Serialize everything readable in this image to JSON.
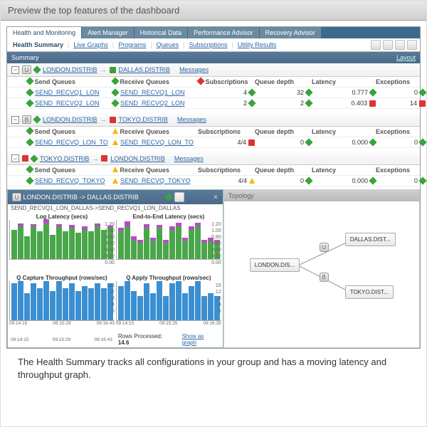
{
  "header": "Preview the top features of the dashboard",
  "tabs": [
    "Health and Monitoring",
    "Alert Manager",
    "Historical Data",
    "Performance Advisor",
    "Recovery Advisor"
  ],
  "subtabs": [
    "Health Summary",
    "Live Graphs",
    "Programs",
    "Queues",
    "Subscriptions",
    "Utility Results"
  ],
  "summary": {
    "title": "Summary",
    "layout": "Layout"
  },
  "groups": [
    {
      "status": "green",
      "badge": "U",
      "src": "LONDON.DISTRIB",
      "dst": "DALLAS.DISTRIB",
      "srcColor": "green",
      "dstColor": "green",
      "msgs": "Messages",
      "cols": [
        "Send Queues",
        "Receive Queues",
        "Subscriptions",
        "Queue depth",
        "Latency",
        "Exceptions"
      ],
      "colIcons": [
        "green",
        "green",
        "red",
        "",
        "",
        ""
      ],
      "rows": [
        {
          "send": "SEND_RECVQ1_LON",
          "recv": "SEND_RECVQ1_LON",
          "subs": "4",
          "subIcon": "green",
          "depth": "32",
          "depthIcon": "green",
          "lat": "0.777",
          "latIcon": "green",
          "exc": "0",
          "excIcon": "green"
        },
        {
          "send": "SEND_RECVQ2_LON",
          "recv": "SEND_RECVQ2_LON",
          "subs": "2",
          "subIcon": "green",
          "depth": "2",
          "depthIcon": "green",
          "lat": "0.403",
          "latIcon": "red",
          "exc": "14",
          "excIcon": "red"
        }
      ]
    },
    {
      "status": "green",
      "badge": "B",
      "src": "LONDON.DISTRIB",
      "dst": "TOKYO.DISTRIB",
      "srcColor": "green",
      "dstColor": "red",
      "msgs": "Messages",
      "cols": [
        "Send Queues",
        "Receive Queues",
        "Subscriptions",
        "Queue depth",
        "Latency",
        "Exceptions"
      ],
      "colIcons": [
        "green",
        "yellow",
        "",
        "",
        "",
        ""
      ],
      "rows": [
        {
          "send": "SEND_RECVQ_LON_TO",
          "recv": "SEND_RECVQ_LON_TO",
          "sendIcon": "green",
          "recvIcon": "yellow",
          "subs": "4/4",
          "subIcon": "red",
          "depth": "0",
          "depthIcon": "green",
          "lat": "0.000",
          "latIcon": "green",
          "exc": "0",
          "excIcon": "green"
        }
      ]
    },
    {
      "status": "red",
      "badge": "",
      "src": "TOKYO.DISTRIB",
      "dst": "LONDON.DISTRIB",
      "srcColor": "",
      "dstColor": "red",
      "msgs": "Messages",
      "cols": [
        "Send Queues",
        "Receive Queues",
        "Subscriptions",
        "Queue depth",
        "Latency",
        "Exceptions"
      ],
      "colIcons": [
        "green",
        "yellow",
        "",
        "",
        "",
        ""
      ],
      "rows": [
        {
          "send": "SEND_RECVQ_TOKYO",
          "recv": "SEND_RECVQ_TOKYO",
          "sendIcon": "green",
          "recvIcon": "yellow",
          "subs": "4/4",
          "subIcon": "yellow",
          "depth": "0",
          "depthIcon": "green",
          "lat": "0.000",
          "latIcon": "green",
          "exc": "0",
          "excIcon": "green"
        }
      ]
    }
  ],
  "chartPanel": {
    "title": "LONDON.DISTRIB -> DALLAS.DISTRIB",
    "crumb": "SEND_RECVQ1_LON_DALLAS->SEND_RECVQ1_LON_DALLAS",
    "titles": [
      "Log Latency (secs)",
      "End-to-End Latency (secs)",
      "Q Capture Throughput (rows/sec)",
      "Q Apply Throughput (rows/sec)"
    ],
    "rowsProcessedLabel": "Rows Processed:",
    "rowsProcessed": "14.6",
    "showAsGraph": "Show as graph",
    "xticks": [
      "09:14:15",
      "09:15:29",
      "09:16:43"
    ],
    "xticks2": [
      "09:14:15",
      "09:15:25",
      "09:16:35"
    ],
    "yLat": [
      "1.20",
      "1.00",
      "0.80",
      "0.60",
      "0.40",
      "0.20",
      "0.00"
    ],
    "yTh": [
      "16",
      "12",
      "8",
      "4",
      "0"
    ]
  },
  "chart_data": [
    {
      "type": "bar",
      "title": "Log Latency (secs)",
      "series": [
        {
          "name": "base",
          "values": [
            0.9,
            1.0,
            0.7,
            1.0,
            0.85,
            1.1,
            0.75,
            1.0,
            0.85,
            0.95,
            0.8,
            0.9,
            0.85,
            1.0,
            0.9,
            0.95
          ]
        },
        {
          "name": "overhead",
          "values": [
            0,
            0.1,
            0,
            0.08,
            0,
            0.12,
            0,
            0.08,
            0,
            0.1,
            0,
            0.1,
            0,
            0.1,
            0,
            0.08
          ]
        }
      ],
      "ylim": [
        0,
        1.2
      ],
      "xticks": [
        "09:14:15",
        "09:15:29",
        "09:16:43"
      ]
    },
    {
      "type": "bar",
      "title": "End-to-End Latency (secs)",
      "series": [
        {
          "name": "base",
          "values": [
            0.85,
            1.0,
            0.6,
            0.5,
            0.95,
            0.55,
            0.95,
            0.5,
            0.9,
            1.0,
            0.55,
            0.9,
            1.0,
            0.5,
            0.55,
            0.5
          ]
        },
        {
          "name": "overhead",
          "values": [
            0.1,
            0.15,
            0.1,
            0.1,
            0.12,
            0.1,
            0.1,
            0.1,
            0.1,
            0.12,
            0.1,
            0.1,
            0.12,
            0.1,
            0.1,
            0.1
          ]
        }
      ],
      "ylim": [
        0,
        1.2
      ],
      "xticks": [
        "09:14:15",
        "09:15:25",
        "09:16:35"
      ]
    },
    {
      "type": "bar",
      "title": "Q Capture Throughput (rows/sec)",
      "values": [
        15,
        16,
        11,
        15,
        13,
        16,
        12,
        16,
        13,
        15,
        12,
        14,
        13,
        15,
        13,
        15
      ],
      "ylim": [
        0,
        16
      ],
      "xticks": [
        "09:14:15",
        "09:15:29",
        "09:16:43"
      ]
    },
    {
      "type": "bar",
      "title": "Q Apply Throughput (rows/sec)",
      "values": [
        14,
        16,
        12,
        10,
        15,
        11,
        16,
        10,
        15,
        16,
        11,
        14,
        16,
        10,
        11,
        10
      ],
      "ylim": [
        0,
        16
      ],
      "xticks": [
        "09:14:15",
        "09:15:25",
        "09:16:35"
      ]
    }
  ],
  "topology": {
    "title": "Topology",
    "nodes": [
      "LONDON.DIS...",
      "DALLAS.DIST...",
      "TOKYO.DIST..."
    ],
    "badges": [
      "U",
      "B"
    ]
  },
  "caption": "The Health Summary tracks all configurations in your group and has a moving latency and throughput graph."
}
